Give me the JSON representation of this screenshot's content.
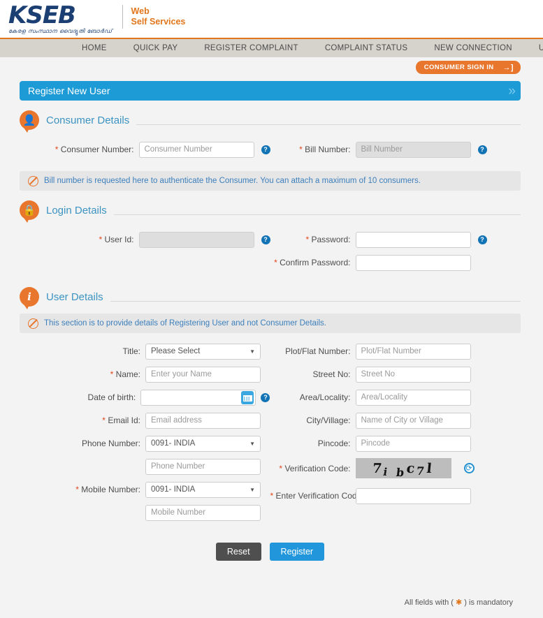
{
  "brand": {
    "logo_text": "KSEB",
    "logo_malayalam": "കേരള സംസ്ഥാന വൈദ്യുതി ബോർഡ്",
    "tagline_line1": "Web",
    "tagline_line2": "Self Services",
    "logo_color": "#1b3f73",
    "accent_color": "#e2761b"
  },
  "nav": {
    "items": [
      {
        "label": "HOME"
      },
      {
        "label": "QUICK PAY"
      },
      {
        "label": "REGISTER COMPLAINT"
      },
      {
        "label": "COMPLAINT STATUS"
      },
      {
        "label": "NEW CONNECTION"
      },
      {
        "label": "USER GUIDE"
      }
    ]
  },
  "signin": {
    "label": "CONSUMER SIGN IN",
    "icon": "sign-in-arrow-icon"
  },
  "titlebar": {
    "title": "Register New User",
    "chevron": "»",
    "color": "#1d9bd7"
  },
  "sections": {
    "consumer": {
      "title": "Consumer Details",
      "icon": "person-icon",
      "info": "Bill number is requested here to authenticate the Consumer. You can attach a maximum of 10 consumers.",
      "fields": {
        "consumer_number": {
          "label": "Consumer Number:",
          "placeholder": "Consumer Number",
          "value": "",
          "required": true
        },
        "bill_number": {
          "label": "Bill Number:",
          "placeholder": "Bill Number",
          "value": "",
          "required": true,
          "disabled": true
        }
      }
    },
    "login": {
      "title": "Login Details",
      "icon": "lock-icon",
      "fields": {
        "user_id": {
          "label": "User Id:",
          "placeholder": "",
          "value": "",
          "required": true,
          "disabled": true
        },
        "password": {
          "label": "Password:",
          "placeholder": "",
          "value": "",
          "required": true
        },
        "confirm_password": {
          "label": "Confirm Password:",
          "placeholder": "",
          "value": "",
          "required": true
        }
      }
    },
    "user": {
      "title": "User Details",
      "icon": "info-icon",
      "info": "This section is to provide details of Registering User and not Consumer Details.",
      "fields": {
        "title": {
          "label": "Title:",
          "selected": "Please Select",
          "required": false
        },
        "name": {
          "label": "Name:",
          "placeholder": "Enter your Name",
          "value": "",
          "required": true
        },
        "dob": {
          "label": "Date of birth:",
          "placeholder": "",
          "value": "",
          "required": false
        },
        "email": {
          "label": "Email Id:",
          "placeholder": "Email address",
          "value": "",
          "required": true
        },
        "phone_code": {
          "label": "Phone Number:",
          "selected": "0091- INDIA",
          "required": false
        },
        "phone_number": {
          "placeholder": "Phone Number",
          "value": ""
        },
        "mobile_code": {
          "label": "Mobile Number:",
          "selected": "0091- INDIA",
          "required": true
        },
        "mobile_number": {
          "placeholder": "Mobile Number",
          "value": ""
        },
        "plot_flat": {
          "label": "Plot/Flat Number:",
          "placeholder": "Plot/Flat Number",
          "value": "",
          "required": false
        },
        "street_no": {
          "label": "Street No:",
          "placeholder": "Street No",
          "value": "",
          "required": false
        },
        "area_locality": {
          "label": "Area/Locality:",
          "placeholder": "Area/Locality",
          "value": "",
          "required": false
        },
        "city_village": {
          "label": "City/Village:",
          "placeholder": "Name of City or Village",
          "value": "",
          "required": false
        },
        "pincode": {
          "label": "Pincode:",
          "placeholder": "Pincode",
          "value": "",
          "required": false
        },
        "verification_code": {
          "label": "Verification Code:",
          "captcha_text": "7ibc7l",
          "required": true
        },
        "enter_verification_code": {
          "label": "Enter Verification Code:",
          "placeholder": "",
          "value": "",
          "required": true
        }
      }
    }
  },
  "buttons": {
    "reset": "Reset",
    "register": "Register"
  },
  "footnote": {
    "prefix": "All fields with ( ",
    "star": "✱",
    "suffix": " ) is mandatory"
  },
  "icons": {
    "help": "?",
    "refresh": "⟳",
    "caret": "▼"
  }
}
